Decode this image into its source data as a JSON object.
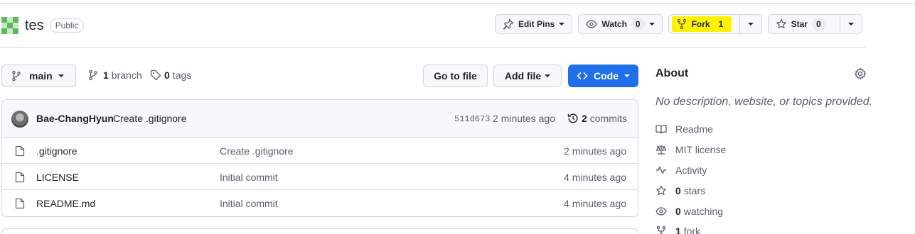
{
  "repo": {
    "name": "tes",
    "visibility": "Public"
  },
  "header_actions": {
    "edit_pins": "Edit Pins",
    "watch": "Watch",
    "watch_count": "0",
    "fork": "Fork",
    "fork_count": "1",
    "star": "Star",
    "star_count": "0"
  },
  "branch_bar": {
    "branch": "main",
    "branch_count": "1",
    "branch_label": "branch",
    "tag_count": "0",
    "tag_label": "tags",
    "go_to_file": "Go to file",
    "add_file": "Add file",
    "code": "Code"
  },
  "latest_commit": {
    "author": "Bae-ChangHyun",
    "message": "Create .gitignore",
    "sha": "511d673",
    "time": "2 minutes ago",
    "commit_count": "2",
    "commit_label": "commits"
  },
  "files": [
    {
      "name": ".gitignore",
      "message": "Create .gitignore",
      "time": "2 minutes ago"
    },
    {
      "name": "LICENSE",
      "message": "Initial commit",
      "time": "4 minutes ago"
    },
    {
      "name": "README.md",
      "message": "Initial commit",
      "time": "4 minutes ago"
    }
  ],
  "about": {
    "title": "About",
    "description": "No description, website, or topics provided.",
    "readme": "Readme",
    "license": "MIT license",
    "activity": "Activity",
    "stars_count": "0",
    "stars_label": "stars",
    "watching_count": "0",
    "watching_label": "watching",
    "fork_count": "1",
    "fork_label": "fork"
  },
  "colors": {
    "code_button": "#1f6feb",
    "highlight": "#fff200"
  }
}
